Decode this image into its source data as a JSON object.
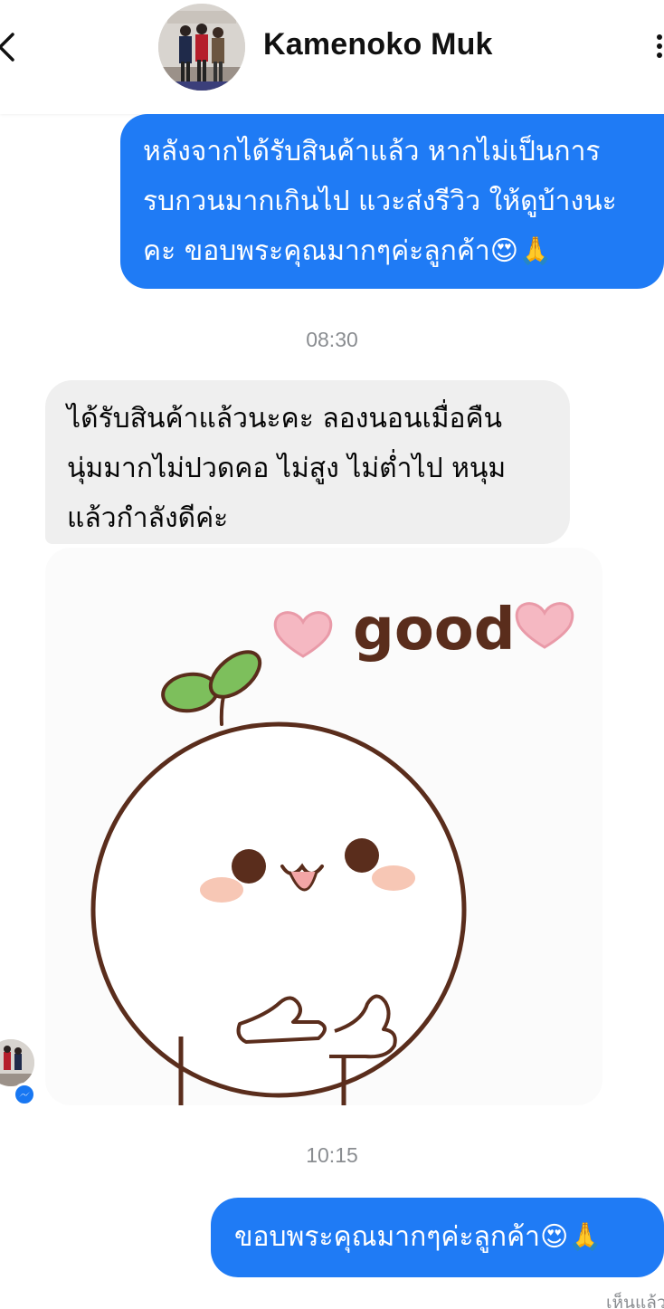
{
  "header": {
    "contact_name": "Kamenoko Muk",
    "back_icon": "chevron-left-icon",
    "menu_icon": "more-vertical-icon"
  },
  "messages": [
    {
      "direction": "outgoing",
      "text": "หลังจากได้รับสินค้าแล้ว หากไม่เป็นการ\nรบกวนมากเกินไป แวะส่งรีวิว ให้ดูบ้างนะ\nคะ ขอบพระคุณมากๆค่ะลูกค้า😍🙏"
    },
    {
      "timestamp": "08:30"
    },
    {
      "direction": "incoming",
      "text": "ได้รับสินค้าแล้วนะคะ ลองนอนเมื่อคืน\nนุ่มมากไม่ปวดคอ ไม่สูง ไม่ต่ำไป หนุม\nแล้วกำลังดีค่ะ"
    },
    {
      "direction": "incoming",
      "type": "sticker",
      "sticker_text": "good"
    },
    {
      "timestamp": "10:15"
    },
    {
      "direction": "outgoing",
      "text": "ขอบพระคุณมากๆค่ะลูกค้า😍🙏"
    }
  ],
  "status": {
    "seen": "เห็นแล้ว"
  },
  "colors": {
    "outgoing_bubble": "#1f7bf5",
    "incoming_bubble": "#efefef",
    "messenger_badge": "#1877f2"
  }
}
